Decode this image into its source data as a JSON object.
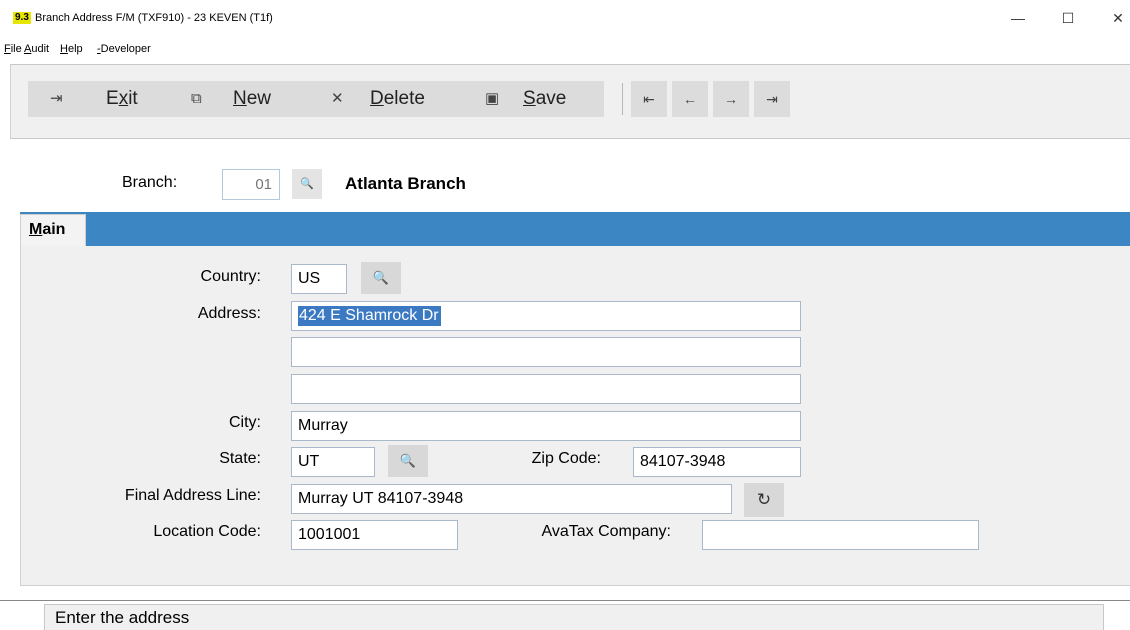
{
  "window": {
    "badge": "9.3",
    "title": "Branch Address F/M (TXF910) - 23 KEVEN (T1f)",
    "controls": {
      "minimize": "—",
      "maximize": "☐",
      "close": "✕"
    }
  },
  "menu": {
    "items": [
      {
        "accel": "F",
        "rest": "ile"
      },
      {
        "accel": "A",
        "rest": "udit"
      },
      {
        "accel": "H",
        "rest": "elp"
      },
      {
        "accel": "-",
        "rest": "Developer"
      }
    ]
  },
  "toolbar": {
    "exit": {
      "icon": "exit-icon",
      "glyph": "⇥",
      "pre": "E",
      "accel": "x",
      "post": "it"
    },
    "new": {
      "icon": "new-document-icon",
      "glyph": "⧉",
      "pre": "",
      "accel": "N",
      "post": "ew"
    },
    "delete": {
      "icon": "delete-icon",
      "glyph": "✕",
      "pre": "",
      "accel": "D",
      "post": "elete"
    },
    "save": {
      "icon": "save-icon",
      "glyph": "▣",
      "pre": "",
      "accel": "S",
      "post": "ave"
    },
    "nav": {
      "first": "⇤",
      "prev": "←",
      "next": "→",
      "last": "⇥"
    }
  },
  "branch": {
    "label": "Branch:",
    "code": "01",
    "lookup_glyph": "🔍",
    "name": "Atlanta Branch"
  },
  "tabs": [
    {
      "accel": "M",
      "rest": "ain",
      "selected": true
    }
  ],
  "form": {
    "country": {
      "label": "Country:",
      "value": "US"
    },
    "address": {
      "label": "Address:",
      "line1": "424 E Shamrock Dr",
      "line2": "",
      "line3": ""
    },
    "city": {
      "label": "City:",
      "value": "Murray"
    },
    "state": {
      "label": "State:",
      "value": "UT"
    },
    "zip": {
      "label": "Zip Code:",
      "value": "84107-3948"
    },
    "final_address": {
      "label": "Final Address Line:",
      "value": "Murray UT 84107-3948"
    },
    "location_code": {
      "label": "Location Code:",
      "value": "1001001"
    },
    "avatax": {
      "label": "AvaTax Company:",
      "value": ""
    },
    "search_glyph": "🔍",
    "refresh_glyph": "↻"
  },
  "status": {
    "text": "Enter the address"
  },
  "colors": {
    "tab_strip": "#3c87c3",
    "selection": "#3b79c3",
    "badge": "#e6e600"
  }
}
